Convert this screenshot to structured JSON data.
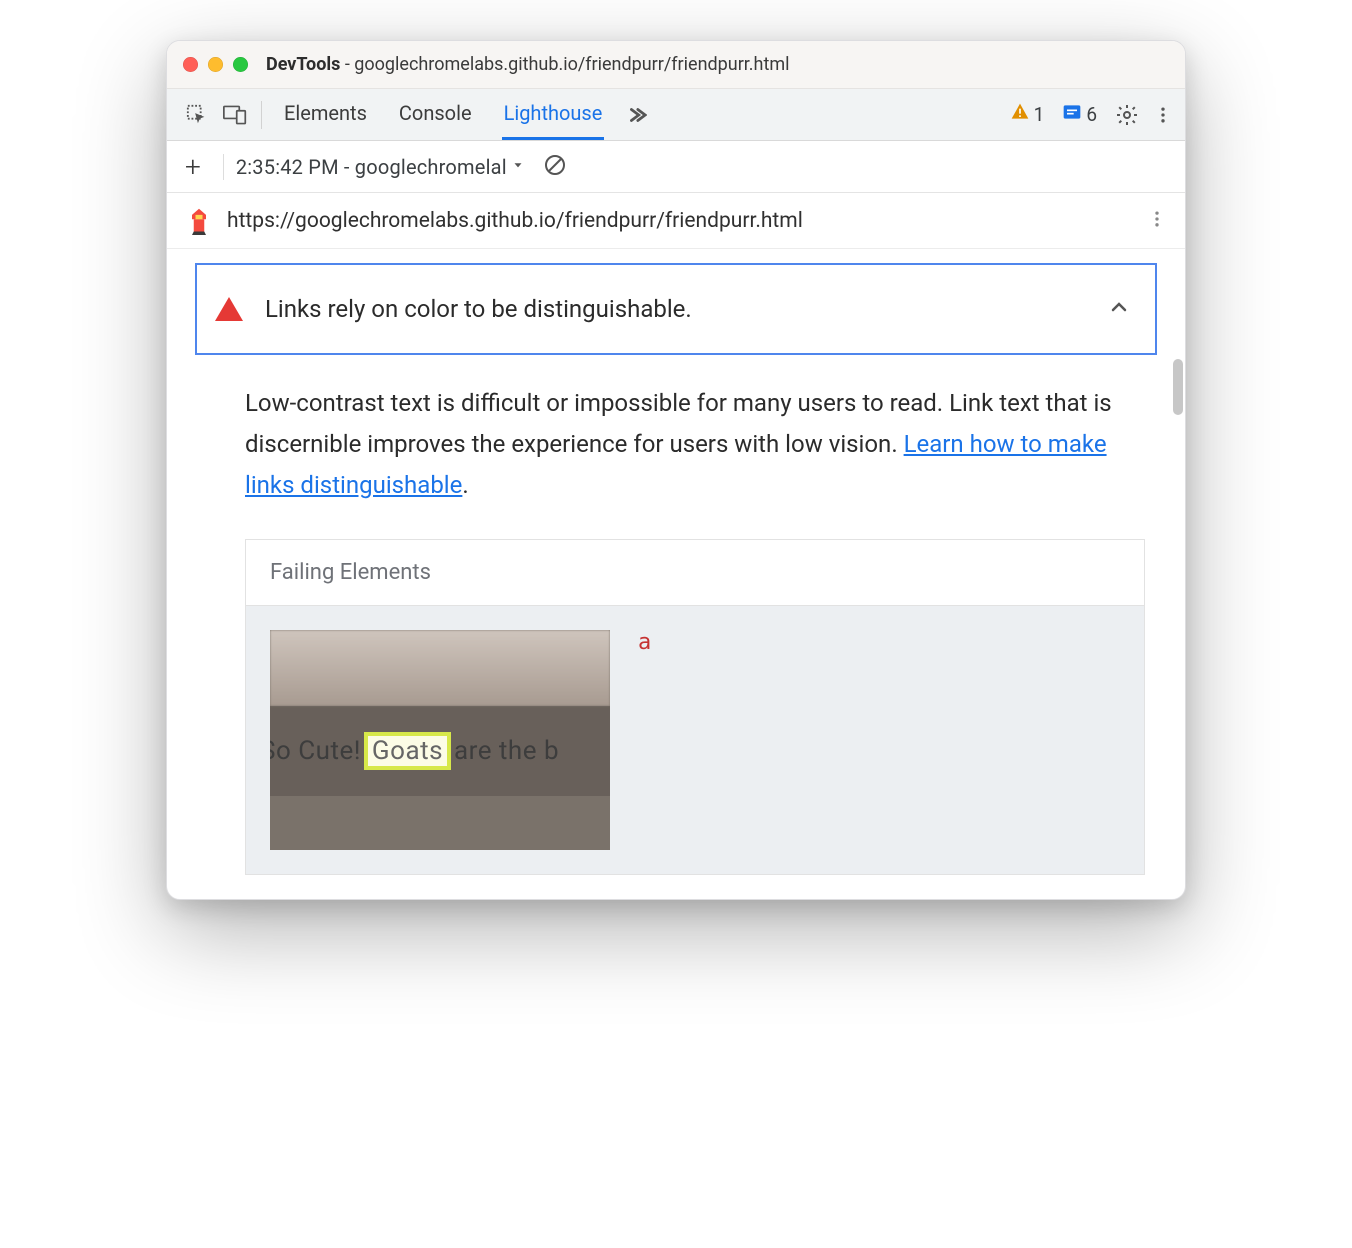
{
  "window": {
    "title_prefix": "DevTools",
    "title_sep": " - ",
    "title_url": "googlechromelabs.github.io/friendpurr/friendpurr.html"
  },
  "panels": {
    "tabs": {
      "elements": "Elements",
      "console": "Console",
      "lighthouse": "Lighthouse"
    },
    "warnings_count": "1",
    "issues_count": "6"
  },
  "history": {
    "entry": "2:35:42 PM - googlechromelal"
  },
  "report": {
    "url": "https://googlechromelabs.github.io/friendpurr/friendpurr.html"
  },
  "audit": {
    "title": "Links rely on color to be distinguishable.",
    "description_before": "Low-contrast text is difficult or impossible for many users to read. Link text that is discernible improves the experience for users with low vision. ",
    "link_text": "Learn how to make links distinguishable",
    "description_after": "."
  },
  "failing": {
    "header": "Failing Elements",
    "selector": "a",
    "thumb_text_before": "So Cute! ",
    "thumb_highlight": "Goats",
    "thumb_text_after": " are the b"
  }
}
